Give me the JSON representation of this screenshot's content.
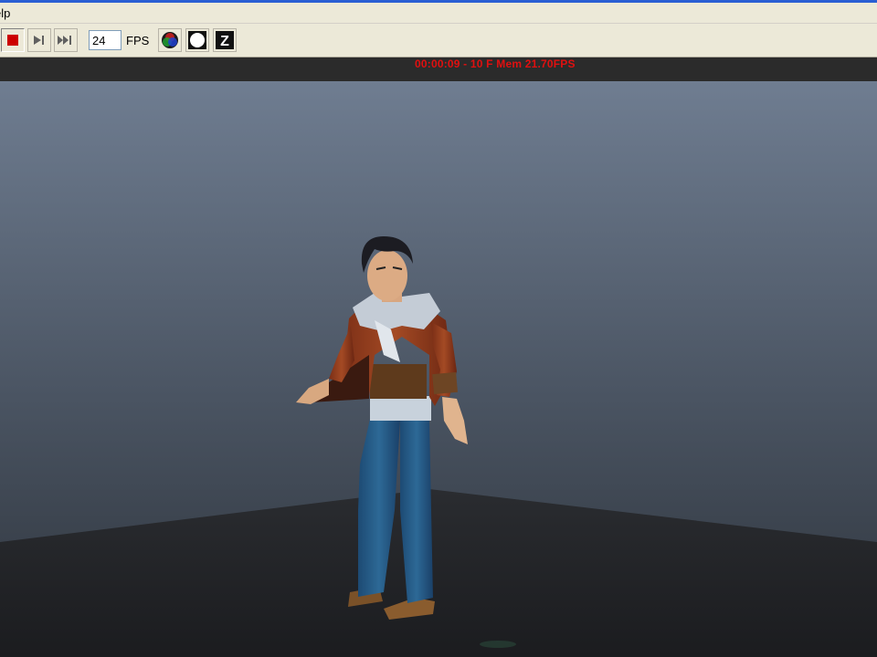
{
  "menubar": {
    "help_label": "elp"
  },
  "toolbar": {
    "stop_icon": "stop-icon",
    "step_icon": "step-forward-icon",
    "end_icon": "skip-to-end-icon",
    "fps_value": "24",
    "fps_label": "FPS",
    "z_label": "Z"
  },
  "hud": {
    "status_text": "00:00:09 - 10 F Mem 21.70FPS"
  },
  "colors": {
    "hud_text": "#e01010",
    "record_red": "#cc0000",
    "toolbar_bg": "#ece9d8"
  }
}
